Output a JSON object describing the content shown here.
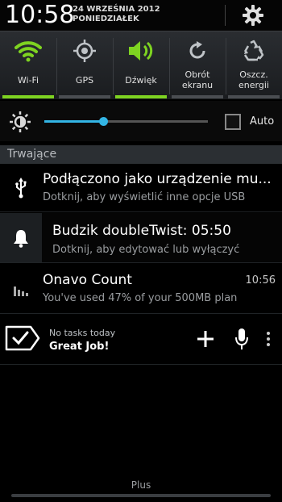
{
  "status_header": {
    "clock": "10:58",
    "date_line1": "24 WRZEŚNIA 2012",
    "date_line2": "PONIEDZIAŁEK",
    "settings_icon": "gear-icon"
  },
  "toggles": [
    {
      "label": "Wi-Fi",
      "icon": "wifi-icon",
      "on": true
    },
    {
      "label": "GPS",
      "icon": "gps-icon",
      "on": false
    },
    {
      "label": "Dźwięk",
      "icon": "sound-icon",
      "on": true
    },
    {
      "label_line1": "Obrót",
      "label_line2": "ekranu",
      "icon": "rotate-icon",
      "on": false
    },
    {
      "label_line1": "Oszcz.",
      "label_line2": "energii",
      "icon": "recycle-icon",
      "on": false
    }
  ],
  "brightness": {
    "level": 0.36,
    "auto_label": "Auto",
    "auto_checked": false
  },
  "section": {
    "title": "Trwające"
  },
  "notifications": [
    {
      "title": "Podłączono jako urządzenie mu...",
      "subtitle": "Dotknij, aby wyświetlić inne opcje USB",
      "icon": "usb-icon"
    },
    {
      "title": "Budzik doubleTwist: 05:50",
      "subtitle": "Dotknij, aby edytować lub wyłączyć",
      "icon": "bell-icon"
    },
    {
      "title": "Onavo Count",
      "subtitle": "You've used 47% of your 500MB plan",
      "time": "10:56",
      "icon": "bar-chart-icon"
    }
  ],
  "anydo": {
    "line1": "No tasks today",
    "line2": "Great Job!",
    "icons": [
      "check-icon",
      "plus-icon",
      "microphone-icon",
      "overflow-menu-icon"
    ]
  },
  "bottom": {
    "label": "Plus"
  },
  "colors": {
    "accent_green": "#7ed321",
    "slider_blue": "#33b5e5"
  }
}
